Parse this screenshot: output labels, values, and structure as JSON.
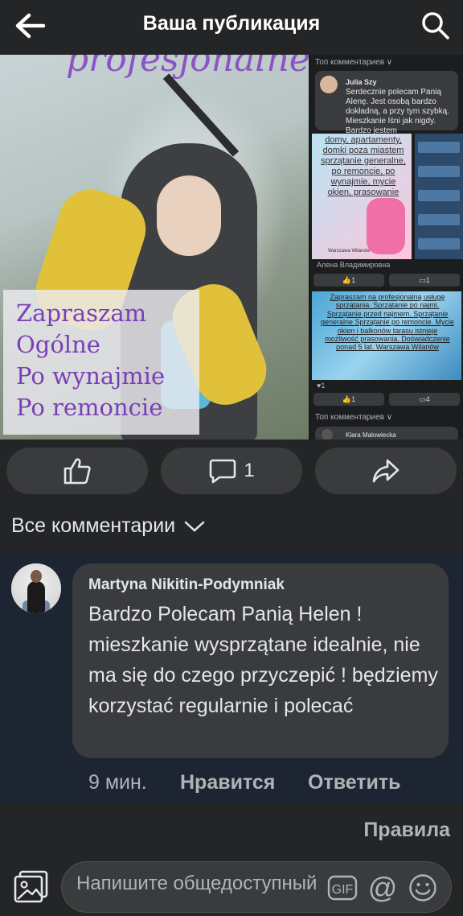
{
  "header": {
    "title": "Ваша публикация",
    "back_icon": "arrow-left-icon",
    "search_icon": "search-icon"
  },
  "post_media": {
    "main_image": {
      "headline": "profesjonalne",
      "lines": [
        "Zapraszam",
        "Ogólne",
        "Po wynajmie",
        "Po remoncie"
      ]
    },
    "side_preview": {
      "top_comments_label": "Топ комментариев ∨",
      "comment_author": "Julia Szy",
      "comment_text": "Serdecznie polecam Panią Alenę. Jest osobą bardzo dokładną, a przy tym szybką. Mieszkanie lśni jak nigdy. Bardzo jestem",
      "flyer1_text": "domy, apartamenty, domki poza miastem sprzątanie generalne, po remoncie, po wynajmie, mycie okien, prasowanie",
      "flyer1_sig": "Warszawa Wilanów",
      "post_author": "Алена Владимировна",
      "row1_likes": "1",
      "row1_comments": "1",
      "flyer2_text": "Zapraszam na profesjonalną usługę sprzątania. Sprzątanie po najmi. Sprzątanie przed najmem. Sprzątanie generalne Sprzątanie po remoncie. Mycie okien i balkonów tarasu istnieje możliwość prasowania. Doświadczenie ponad 5 lat. Warszawa Wilanów",
      "reaction_count": "1",
      "row2_likes": "1",
      "row2_comments": "4",
      "top_comments_label_2": "Топ комментариев ∨",
      "comment2_author": "Klara Malowiecka"
    }
  },
  "actions": {
    "like_icon": "thumbs-up-icon",
    "comment_icon": "comment-icon",
    "comment_count": "1",
    "share_icon": "share-icon"
  },
  "comments": {
    "filter_label": "Все комментарии",
    "items": [
      {
        "author": "Martyna Nikitin-Podymniak",
        "text": "Bardzo Polecam Panią Helen ! mieszkanie wysprzątane idealnie, nie ma się do czego przyczepić ! będziemy korzystać regularnie i polecać",
        "time": "9 мин.",
        "like_label": "Нравится",
        "reply_label": "Ответить"
      }
    ]
  },
  "rules_label": "Правила",
  "composer": {
    "placeholder": "Напишите общедоступный",
    "gif_label": "GIF",
    "at_label": "@"
  }
}
